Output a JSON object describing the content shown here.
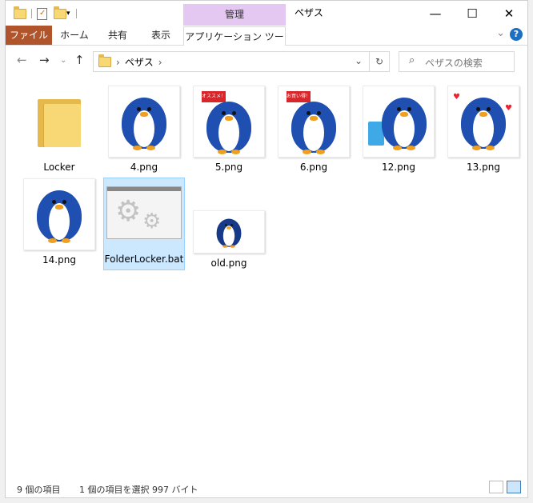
{
  "window": {
    "title": "ペザス",
    "tool_header": "管理",
    "minimize": "—",
    "maximize": "☐",
    "close": "✕"
  },
  "ribbon": {
    "tabs": [
      {
        "label": "ファイル"
      },
      {
        "label": "ホーム"
      },
      {
        "label": "共有"
      },
      {
        "label": "表示"
      },
      {
        "label": "アプリケーション ツール"
      }
    ],
    "help": "?"
  },
  "address": {
    "path": [
      "ペザス"
    ],
    "search_placeholder": "ペザスの検索"
  },
  "files": [
    {
      "name": "Locker",
      "type": "folder"
    },
    {
      "name": "4.png",
      "type": "image"
    },
    {
      "name": "5.png",
      "type": "image",
      "flag": "オススメ！"
    },
    {
      "name": "6.png",
      "type": "image",
      "flag": "お買い得！"
    },
    {
      "name": "12.png",
      "type": "image"
    },
    {
      "name": "13.png",
      "type": "image"
    },
    {
      "name": "14.png",
      "type": "image"
    },
    {
      "name": "FolderLocker.bat",
      "type": "bat",
      "selected": true
    },
    {
      "name": "old.png",
      "type": "image"
    }
  ],
  "status": {
    "count": "9 個の項目",
    "selection": "1 個の項目を選択  997 バイト"
  },
  "colors": {
    "file_tab": "#b0552b",
    "tool_header": "#e5c8f2",
    "selection_bg": "#cce8ff",
    "penguin_blue": "#1f4fb0"
  }
}
